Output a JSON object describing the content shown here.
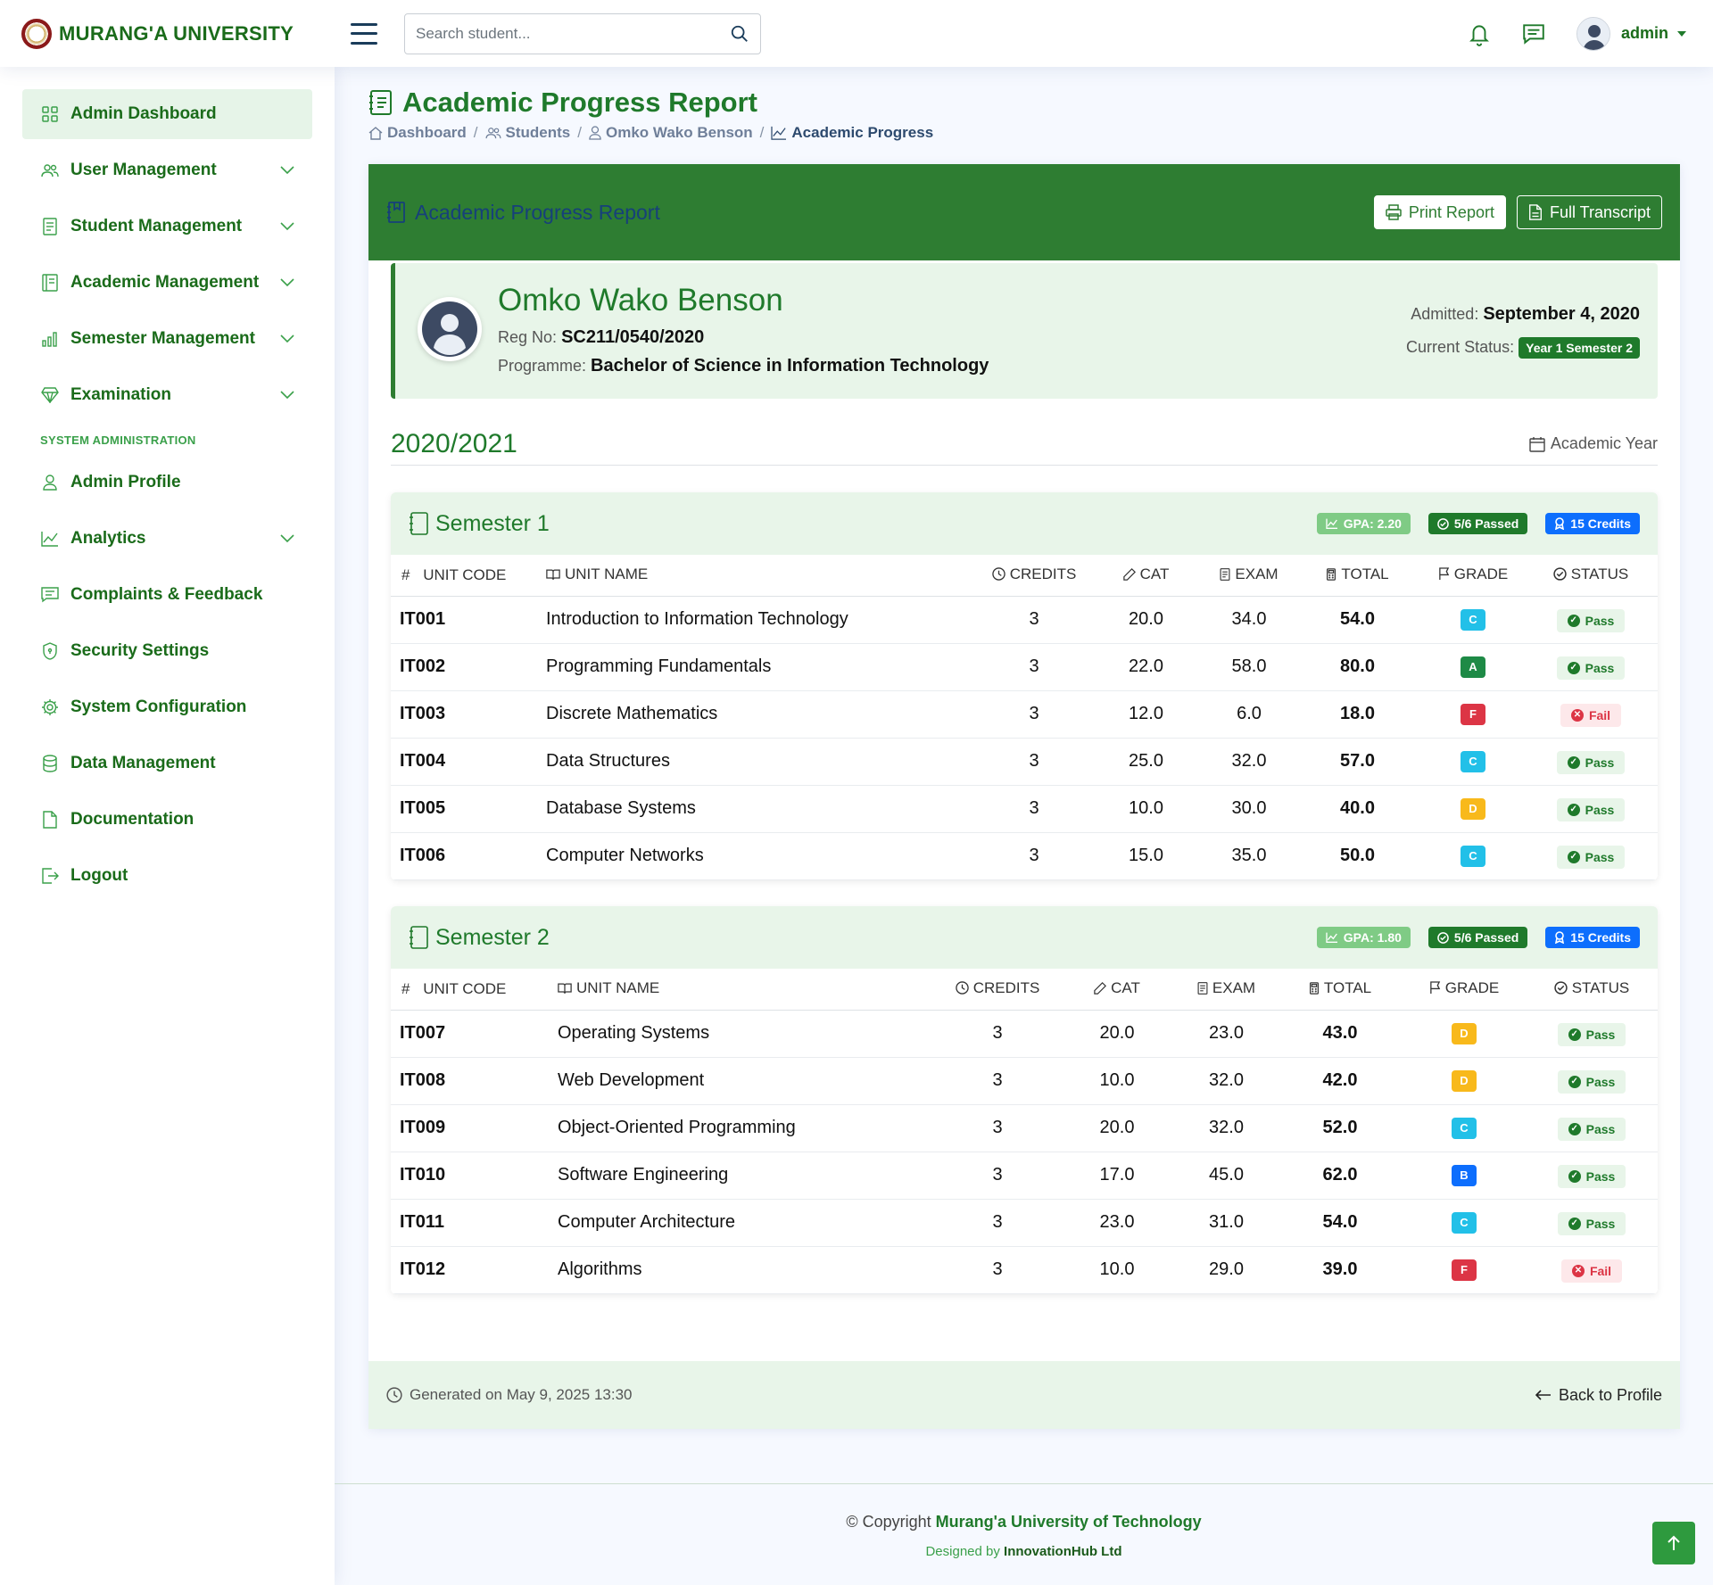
{
  "brand": {
    "name": "MURANG'A UNIVERSITY"
  },
  "header": {
    "search_placeholder": "Search student...",
    "user_name": "admin"
  },
  "sidebar": {
    "items": [
      {
        "label": "Admin Dashboard",
        "icon": "grid-icon",
        "active": true,
        "chevron": false
      },
      {
        "label": "User Management",
        "icon": "people-icon",
        "chevron": true
      },
      {
        "label": "Student Management",
        "icon": "file-text-icon",
        "chevron": true
      },
      {
        "label": "Academic Management",
        "icon": "journal-icon",
        "chevron": true
      },
      {
        "label": "Semester Management",
        "icon": "bar-chart-icon",
        "chevron": true
      },
      {
        "label": "Examination",
        "icon": "gem-icon",
        "chevron": true
      }
    ],
    "section_heading": "SYSTEM ADMINISTRATION",
    "admin_items": [
      {
        "label": "Admin Profile",
        "icon": "person-icon",
        "chevron": false
      },
      {
        "label": "Analytics",
        "icon": "graph-icon",
        "chevron": true
      },
      {
        "label": "Complaints & Feedback",
        "icon": "chat-icon",
        "chevron": false
      },
      {
        "label": "Security Settings",
        "icon": "shield-icon",
        "chevron": false
      },
      {
        "label": "System Configuration",
        "icon": "gear-icon",
        "chevron": false
      },
      {
        "label": "Data Management",
        "icon": "database-icon",
        "chevron": false
      },
      {
        "label": "Documentation",
        "icon": "document-icon",
        "chevron": false
      },
      {
        "label": "Logout",
        "icon": "logout-icon",
        "chevron": false
      }
    ]
  },
  "page": {
    "title": "Academic Progress Report",
    "breadcrumb": [
      "Dashboard",
      "Students",
      "Omko Wako Benson",
      "Academic Progress"
    ]
  },
  "report": {
    "header_title": "Academic Progress Report",
    "print_label": "Print Report",
    "transcript_label": "Full Transcript",
    "student": {
      "name": "Omko Wako Benson",
      "reg_label": "Reg No:",
      "reg_no": "SC211/0540/2020",
      "programme_label": "Programme:",
      "programme": "Bachelor of Science in Information Technology",
      "admitted_label": "Admitted:",
      "admitted": "September 4, 2020",
      "status_label": "Current Status:",
      "status": "Year 1 Semester 2"
    },
    "academic_year": "2020/2021",
    "academic_year_label": "Academic Year",
    "columns": [
      "#",
      "UNIT CODE",
      "UNIT NAME",
      "CREDITS",
      "CAT",
      "EXAM",
      "TOTAL",
      "GRADE",
      "STATUS"
    ],
    "semesters": [
      {
        "title": "Semester 1",
        "gpa": "GPA: 2.20",
        "passed": "5/6 Passed",
        "credits": "15 Credits",
        "units": [
          {
            "code": "IT001",
            "name": "Introduction to Information Technology",
            "credits": "3",
            "cat": "20.0",
            "exam": "34.0",
            "total": "54.0",
            "grade": "C",
            "status": "Pass"
          },
          {
            "code": "IT002",
            "name": "Programming Fundamentals",
            "credits": "3",
            "cat": "22.0",
            "exam": "58.0",
            "total": "80.0",
            "grade": "A",
            "status": "Pass"
          },
          {
            "code": "IT003",
            "name": "Discrete Mathematics",
            "credits": "3",
            "cat": "12.0",
            "exam": "6.0",
            "total": "18.0",
            "grade": "F",
            "status": "Fail"
          },
          {
            "code": "IT004",
            "name": "Data Structures",
            "credits": "3",
            "cat": "25.0",
            "exam": "32.0",
            "total": "57.0",
            "grade": "C",
            "status": "Pass"
          },
          {
            "code": "IT005",
            "name": "Database Systems",
            "credits": "3",
            "cat": "10.0",
            "exam": "30.0",
            "total": "40.0",
            "grade": "D",
            "status": "Pass"
          },
          {
            "code": "IT006",
            "name": "Computer Networks",
            "credits": "3",
            "cat": "15.0",
            "exam": "35.0",
            "total": "50.0",
            "grade": "C",
            "status": "Pass"
          }
        ]
      },
      {
        "title": "Semester 2",
        "gpa": "GPA: 1.80",
        "passed": "5/6 Passed",
        "credits": "15 Credits",
        "units": [
          {
            "code": "IT007",
            "name": "Operating Systems",
            "credits": "3",
            "cat": "20.0",
            "exam": "23.0",
            "total": "43.0",
            "grade": "D",
            "status": "Pass"
          },
          {
            "code": "IT008",
            "name": "Web Development",
            "credits": "3",
            "cat": "10.0",
            "exam": "32.0",
            "total": "42.0",
            "grade": "D",
            "status": "Pass"
          },
          {
            "code": "IT009",
            "name": "Object-Oriented Programming",
            "credits": "3",
            "cat": "20.0",
            "exam": "32.0",
            "total": "52.0",
            "grade": "C",
            "status": "Pass"
          },
          {
            "code": "IT010",
            "name": "Software Engineering",
            "credits": "3",
            "cat": "17.0",
            "exam": "45.0",
            "total": "62.0",
            "grade": "B",
            "status": "Pass"
          },
          {
            "code": "IT011",
            "name": "Computer Architecture",
            "credits": "3",
            "cat": "23.0",
            "exam": "31.0",
            "total": "54.0",
            "grade": "C",
            "status": "Pass"
          },
          {
            "code": "IT012",
            "name": "Algorithms",
            "credits": "3",
            "cat": "10.0",
            "exam": "29.0",
            "total": "39.0",
            "grade": "F",
            "status": "Fail"
          }
        ]
      }
    ],
    "generated": "Generated on May 9, 2025 13:30",
    "back_label": "Back to Profile"
  },
  "footer": {
    "copyright_prefix": "© Copyright",
    "copyright_org": "Murang'a University of Technology",
    "designed_prefix": "Designed by",
    "designed_org": "InnovationHub Ltd"
  },
  "colors": {
    "brand_green": "#2e7d32",
    "text_green": "#1f7a2b",
    "light_green": "#e8f5e9",
    "pass": "#1f7a2b",
    "fail": "#dc3545",
    "credits_blue": "#0d6efd"
  }
}
